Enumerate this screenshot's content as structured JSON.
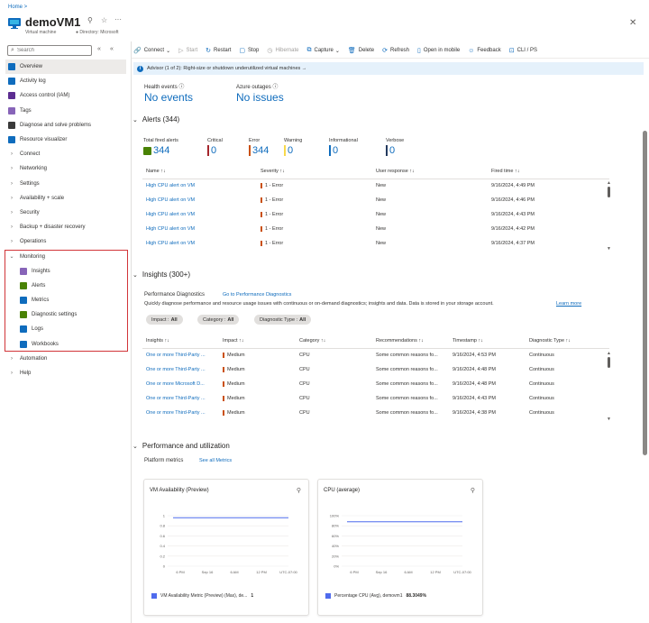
{
  "breadcrumb": "Home  >",
  "resource": {
    "title": "demoVM1",
    "subtitle": "Virtual machine",
    "directory": "Directory: Microsoft",
    "more": "···"
  },
  "sidebar": {
    "search_placeholder": "Search",
    "items": [
      {
        "label": "Overview",
        "icon": "monitor",
        "color": "#0f6cbd",
        "active": true,
        "type": "icon"
      },
      {
        "label": "Activity log",
        "icon": "log",
        "color": "#0f6cbd",
        "type": "icon"
      },
      {
        "label": "Access control (IAM)",
        "icon": "people",
        "color": "#5c2d91",
        "type": "icon"
      },
      {
        "label": "Tags",
        "icon": "tag",
        "color": "#8764b8",
        "type": "icon"
      },
      {
        "label": "Diagnose and solve problems",
        "icon": "wrench",
        "color": "#3a3a3a",
        "type": "icon"
      },
      {
        "label": "Resource visualizer",
        "icon": "graph",
        "color": "#0f6cbd",
        "type": "icon"
      },
      {
        "label": "Connect",
        "type": "group"
      },
      {
        "label": "Networking",
        "type": "group"
      },
      {
        "label": "Settings",
        "type": "group"
      },
      {
        "label": "Availability + scale",
        "type": "group"
      },
      {
        "label": "Security",
        "type": "group"
      },
      {
        "label": "Backup + disaster recovery",
        "type": "group"
      },
      {
        "label": "Operations",
        "type": "group"
      },
      {
        "label": "Monitoring",
        "type": "group-open"
      },
      {
        "label": "Insights",
        "icon": "bulb",
        "color": "#8764b8",
        "type": "child"
      },
      {
        "label": "Alerts",
        "icon": "alert",
        "color": "#498205",
        "type": "child"
      },
      {
        "label": "Metrics",
        "icon": "bars",
        "color": "#0f6cbd",
        "type": "child"
      },
      {
        "label": "Diagnostic settings",
        "icon": "diag",
        "color": "#498205",
        "type": "child"
      },
      {
        "label": "Logs",
        "icon": "logs",
        "color": "#0f6cbd",
        "type": "child"
      },
      {
        "label": "Workbooks",
        "icon": "book",
        "color": "#0f6cbd",
        "type": "child"
      },
      {
        "label": "Automation",
        "type": "group"
      },
      {
        "label": "Help",
        "type": "group"
      }
    ]
  },
  "toolbar": [
    {
      "label": "Connect",
      "icon": "🔗",
      "caret": true
    },
    {
      "label": "Start",
      "icon": "▷",
      "disabled": true
    },
    {
      "label": "Restart",
      "icon": "↻"
    },
    {
      "label": "Stop",
      "icon": "▢"
    },
    {
      "label": "Hibernate",
      "icon": "◷",
      "disabled": true
    },
    {
      "label": "Capture",
      "icon": "⧉",
      "caret": true
    },
    {
      "label": "Delete",
      "icon": "🗑"
    },
    {
      "label": "Refresh",
      "icon": "⟳"
    },
    {
      "label": "Open in mobile",
      "icon": "▯"
    },
    {
      "label": "Feedback",
      "icon": "☺"
    },
    {
      "label": "CLI / PS",
      "icon": "⊡"
    }
  ],
  "banner": "Advisor (1 of 2): Right-size or shutdown underutilized virtual machines  →",
  "health": {
    "label": "Health events ⓘ",
    "value": "No events"
  },
  "outages": {
    "label": "Azure outages ⓘ",
    "value": "No issues"
  },
  "alerts": {
    "title": "Alerts (344)",
    "summary": [
      {
        "label": "Total fired alerts",
        "value": "344",
        "color": "#498205"
      },
      {
        "label": "Critical",
        "value": "0",
        "color": "#a4262c"
      },
      {
        "label": "Error",
        "value": "344",
        "color": "#ca5010"
      },
      {
        "label": "Warning",
        "value": "0",
        "color": "#f7d94c"
      },
      {
        "label": "Informational",
        "value": "0",
        "color": "#0f6cbd"
      },
      {
        "label": "Verbose",
        "value": "0",
        "color": "#243a5e"
      }
    ],
    "columns": [
      "Name ↑↓",
      "Severity ↑↓",
      "User response ↑↓",
      "Fired time ↑↓"
    ],
    "rows": [
      [
        "High CPU alert on VM",
        "1 - Error",
        "New",
        "9/16/2024, 4:49 PM"
      ],
      [
        "High CPU alert on VM",
        "1 - Error",
        "New",
        "9/16/2024, 4:46 PM"
      ],
      [
        "High CPU alert on VM",
        "1 - Error",
        "New",
        "9/16/2024, 4:43 PM"
      ],
      [
        "High CPU alert on VM",
        "1 - Error",
        "New",
        "9/16/2024, 4:42 PM"
      ],
      [
        "High CPU alert on VM",
        "1 - Error",
        "New",
        "9/16/2024, 4:37 PM"
      ]
    ]
  },
  "insights": {
    "title": "Insights (300+)",
    "perf_label": "Performance Diagnostics",
    "perf_link": "Go to Performance Diagnostics",
    "desc": "Quickly diagnose performance and resource usage issues with continuous or on-demand diagnostics; insights and data. Data is stored in your storage account.",
    "learn": "Learn more",
    "filters": [
      {
        "label": "Impact :",
        "value": "All"
      },
      {
        "label": "Category :",
        "value": "All"
      },
      {
        "label": "Diagnostic Type :",
        "value": "All"
      }
    ],
    "columns": [
      "Insights ↑↓",
      "Impact ↑↓",
      "Category ↑↓",
      "Recommendations ↑↓",
      "Timestamp ↑↓",
      "Diagnostic Type ↑↓"
    ],
    "rows": [
      [
        "One or more Third-Party ...",
        "Medium",
        "CPU",
        "Some common reasons fo...",
        "9/16/2024, 4:53 PM",
        "Continuous"
      ],
      [
        "One or more Third-Party ...",
        "Medium",
        "CPU",
        "Some common reasons fo...",
        "9/16/2024, 4:48 PM",
        "Continuous"
      ],
      [
        "One or more Microsoft D...",
        "Medium",
        "CPU",
        "Some common reasons fo...",
        "9/16/2024, 4:48 PM",
        "Continuous"
      ],
      [
        "One or more Third-Party ...",
        "Medium",
        "CPU",
        "Some common reasons fo...",
        "9/16/2024, 4:43 PM",
        "Continuous"
      ],
      [
        "One or more Third-Party ...",
        "Medium",
        "CPU",
        "Some common reasons fo...",
        "9/16/2024, 4:38 PM",
        "Continuous"
      ]
    ]
  },
  "performance": {
    "title": "Performance and utilization",
    "platform_label": "Platform metrics",
    "platform_link": "See all Metrics"
  },
  "charts": [
    {
      "title": "VM Availability (Preview)",
      "yticks": [
        "1",
        "0.8",
        "0.6",
        "0.4",
        "0.2",
        "0"
      ],
      "xticks": [
        "6 PM",
        "Sep 16",
        "6 AM",
        "12 PM",
        "UTC-07:00"
      ],
      "level": 0.96,
      "legend": "VM Availability Metric (Preview) (Max), de...",
      "legend_value": "1"
    },
    {
      "title": "CPU (average)",
      "yticks": [
        "100%",
        "80%",
        "60%",
        "40%",
        "20%",
        "0%"
      ],
      "xticks": [
        "6 PM",
        "Sep 16",
        "6 AM",
        "12 PM",
        "UTC-07:00"
      ],
      "level": 0.88,
      "legend": "Percentage CPU (Avg), demovm1",
      "legend_value": "88.3049%"
    }
  ]
}
